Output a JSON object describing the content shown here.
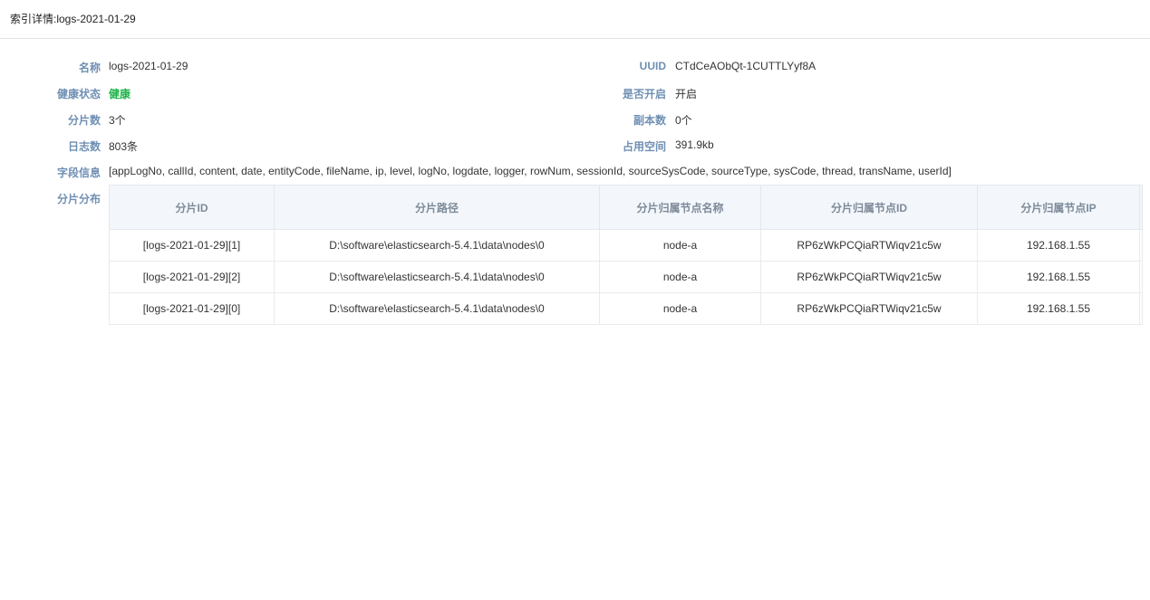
{
  "header": {
    "title": "索引详情:logs-2021-01-29"
  },
  "info": {
    "name_label": "名称",
    "name_value": "logs-2021-01-29",
    "uuid_label": "UUID",
    "uuid_value": "CTdCeAObQt-1CUTTLYyf8A",
    "health_label": "健康状态",
    "health_value": "健康",
    "open_label": "是否开启",
    "open_value": "开启",
    "shards_label": "分片数",
    "shards_value": "3个",
    "replicas_label": "副本数",
    "replicas_value": "0个",
    "logs_label": "日志数",
    "logs_value": "803条",
    "space_label": "占用空间",
    "space_value": "391.9kb",
    "fields_label": "字段信息",
    "fields_value": "[appLogNo, callId, content, date, entityCode, fileName, ip, level, logNo, logdate, logger, rowNum, sessionId, sourceSysCode, sourceType, sysCode, thread, transName, userId]",
    "distribution_label": "分片分布"
  },
  "shard_table": {
    "headers": [
      "分片ID",
      "分片路径",
      "分片归属节点名称",
      "分片归属节点ID",
      "分片归属节点IP"
    ],
    "rows": [
      [
        "[logs-2021-01-29][1]",
        "D:\\software\\elasticsearch-5.4.1\\data\\nodes\\0",
        "node-a",
        "RP6zWkPCQiaRTWiqv21c5w",
        "192.168.1.55"
      ],
      [
        "[logs-2021-01-29][2]",
        "D:\\software\\elasticsearch-5.4.1\\data\\nodes\\0",
        "node-a",
        "RP6zWkPCQiaRTWiqv21c5w",
        "192.168.1.55"
      ],
      [
        "[logs-2021-01-29][0]",
        "D:\\software\\elasticsearch-5.4.1\\data\\nodes\\0",
        "node-a",
        "RP6zWkPCQiaRTWiqv21c5w",
        "192.168.1.55"
      ]
    ]
  }
}
